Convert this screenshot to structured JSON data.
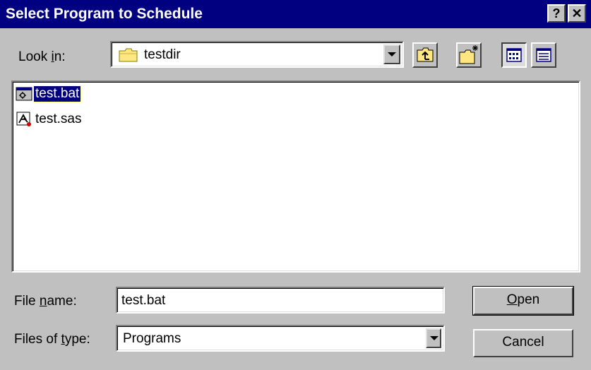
{
  "window": {
    "title": "Select Program to Schedule",
    "help_glyph": "?",
    "close_glyph": "✕"
  },
  "look_in": {
    "label_pre": "Look ",
    "label_accel": "i",
    "label_post": "n:",
    "value": "testdir",
    "folder_icon": "folder-icon"
  },
  "toolbar": {
    "buttons": [
      {
        "name": "up-one-level",
        "icon": "folder-up-icon"
      },
      {
        "name": "create-new-folder",
        "icon": "new-folder-icon"
      },
      {
        "name": "list-view",
        "icon": "list-view-icon",
        "pressed": true
      },
      {
        "name": "details-view",
        "icon": "details-view-icon",
        "pressed": false
      }
    ]
  },
  "files": [
    {
      "name": "test.bat",
      "icon": "batch-file-icon",
      "selected": true
    },
    {
      "name": "test.sas",
      "icon": "sas-program-icon",
      "selected": false
    }
  ],
  "file_name": {
    "label_pre": "File ",
    "label_accel": "n",
    "label_post": "ame:",
    "value": "test.bat"
  },
  "files_of_type": {
    "label_pre": "Files of ",
    "label_accel": "t",
    "label_post": "ype:",
    "value": "Programs"
  },
  "buttons": {
    "open_accel": "O",
    "open_rest": "pen",
    "cancel": "Cancel"
  },
  "colors": {
    "titlebar": "#000080",
    "face": "#c0c0c0",
    "selection": "#000080"
  }
}
